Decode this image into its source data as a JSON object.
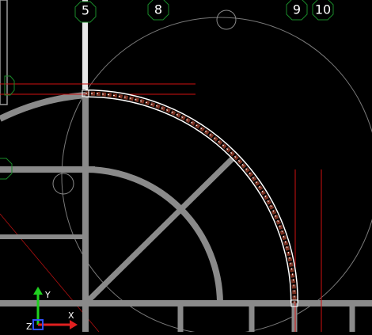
{
  "app": {
    "background": "#000000"
  },
  "grid_bubbles": {
    "labels": [
      "5",
      "8",
      "9",
      "10"
    ],
    "stroke_color": "#1a8a2a"
  },
  "ucs": {
    "x_label": "X",
    "y_label": "Y",
    "z_label": "Z",
    "x_color": "#e02020",
    "y_color": "#20d020",
    "z_color": "#3050ff"
  },
  "colors": {
    "wall": "#8a8a8a",
    "red_line": "#d01010",
    "circle": "#7a7a7a",
    "arc_highlight": "#ffffff",
    "arc_brick": "#7a3020",
    "grip": "#1a8a2a"
  }
}
